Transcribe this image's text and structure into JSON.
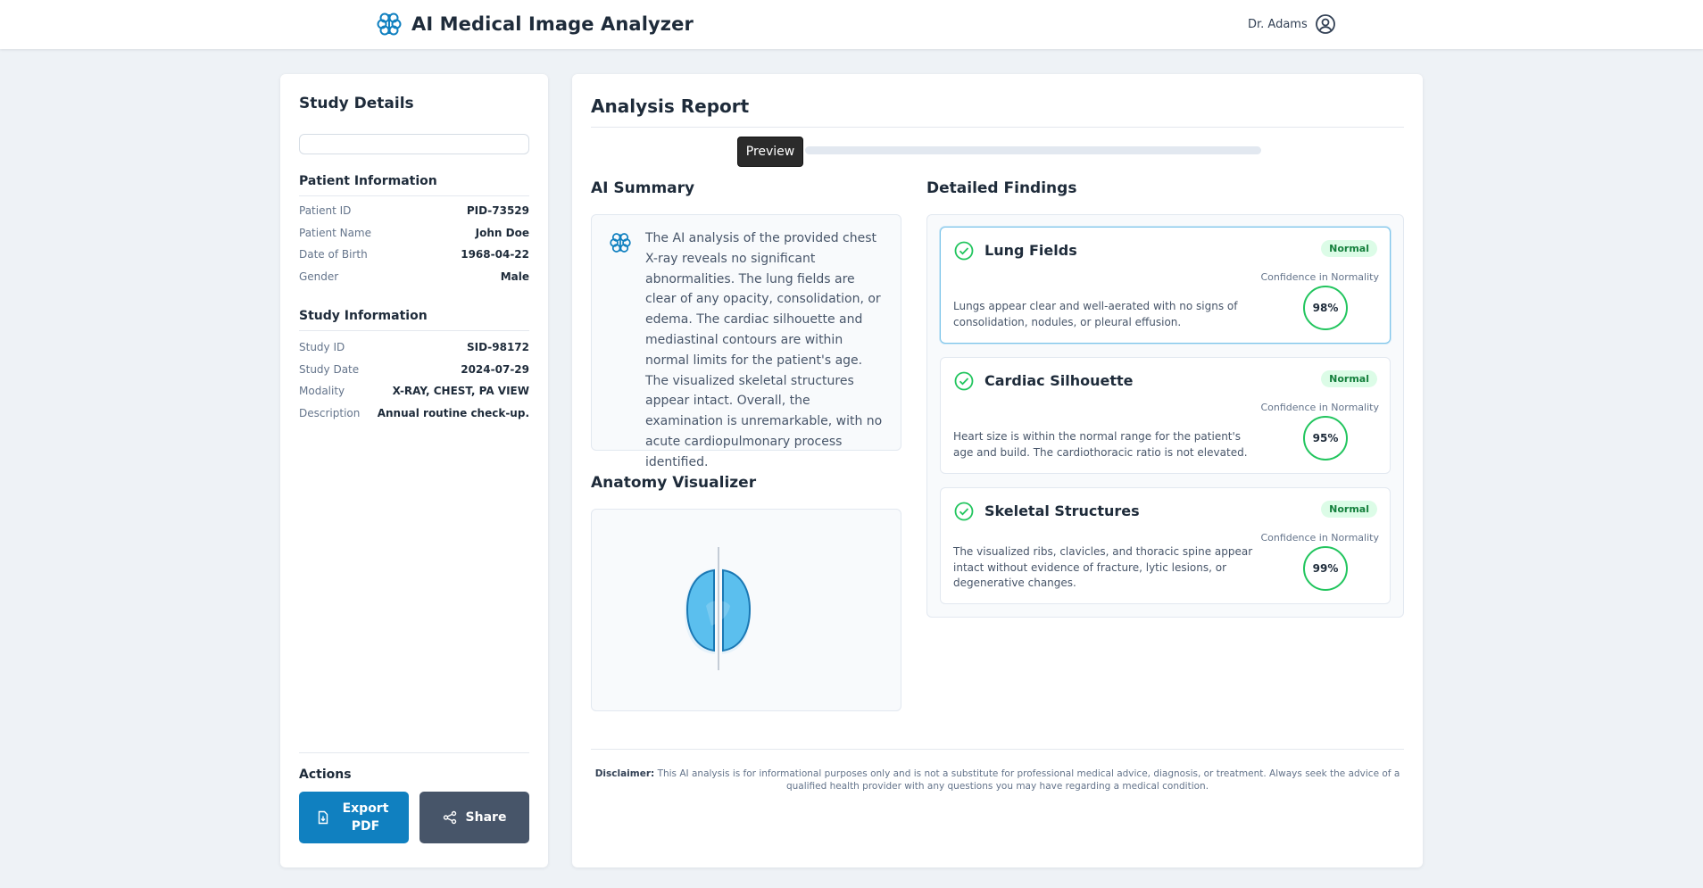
{
  "app": {
    "title": "AI Medical Image Analyzer",
    "icon": "brain-icon",
    "user_name": "Dr. Adams",
    "user_icon": "user-circle-icon"
  },
  "sidebar": {
    "title": "Study Details",
    "search_value": "",
    "patient_info": {
      "heading": "Patient Information",
      "rows": [
        {
          "label": "Patient ID",
          "value": "PID-73529"
        },
        {
          "label": "Patient Name",
          "value": "John Doe"
        },
        {
          "label": "Date of Birth",
          "value": "1968-04-22"
        },
        {
          "label": "Gender",
          "value": "Male"
        }
      ]
    },
    "study_info": {
      "heading": "Study Information",
      "rows": [
        {
          "label": "Study ID",
          "value": "SID-98172"
        },
        {
          "label": "Study Date",
          "value": "2024-07-29"
        },
        {
          "label": "Modality",
          "value": "X-RAY, CHEST, PA VIEW"
        },
        {
          "label": "Description",
          "value": "Annual routine check-up."
        }
      ]
    },
    "actions": {
      "heading": "Actions",
      "export_label": "Export PDF",
      "share_label": "Share"
    }
  },
  "report": {
    "title": "Analysis Report",
    "tooltip": "Preview",
    "ai_summary": {
      "heading": "AI Summary",
      "text": "The AI analysis of the provided chest X-ray reveals no significant abnormalities. The lung fields are clear of any opacity, consolidation, or edema. The cardiac silhouette and mediastinal contours are within normal limits for the patient's age. The visualized skeletal structures appear intact. Overall, the examination is unremarkable, with no acute cardiopulmonary process identified."
    },
    "anatomy": {
      "heading": "Anatomy Visualizer"
    },
    "findings": {
      "heading": "Detailed Findings",
      "items": [
        {
          "title": "Lung Fields",
          "status": "Normal",
          "confidence_label": "Confidence in Normality",
          "confidence": "98%",
          "description": "Lungs appear clear and well-aerated with no signs of consolidation, nodules, or pleural effusion."
        },
        {
          "title": "Cardiac Silhouette",
          "status": "Normal",
          "confidence_label": "Confidence in Normality",
          "confidence": "95%",
          "description": "Heart size is within the normal range for the patient's age and build. The cardiothoracic ratio is not elevated."
        },
        {
          "title": "Skeletal Structures",
          "status": "Normal",
          "confidence_label": "Confidence in Normality",
          "confidence": "99%",
          "description": "The visualized ribs, clavicles, and thoracic spine appear intact without evidence of fracture, lytic lesions, or degenerative changes."
        }
      ]
    },
    "disclaimer": {
      "label": "Disclaimer:",
      "text": "This AI analysis is for informational purposes only and is not a substitute for professional medical advice, diagnosis, or treatment. Always seek the advice of a qualified health provider with any questions you may have regarding a medical condition."
    }
  },
  "colors": {
    "accent": "#1080c0",
    "success": "#22c55e",
    "badge_bg": "#dcfce7",
    "badge_text": "#15803d",
    "share_button": "#475569"
  }
}
